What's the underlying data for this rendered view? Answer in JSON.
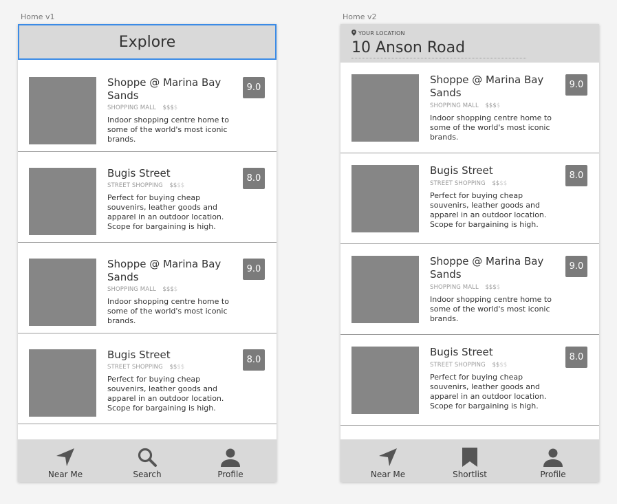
{
  "artboards": {
    "v1_label": "Home v1",
    "v2_label": "Home v2"
  },
  "v1": {
    "header_title": "Explore",
    "tabs": [
      {
        "label": "Near Me",
        "icon": "navigation-arrow-icon"
      },
      {
        "label": "Search",
        "icon": "search-icon"
      },
      {
        "label": "Profile",
        "icon": "person-icon"
      }
    ]
  },
  "v2": {
    "location_label": "YOUR LOCATION",
    "location_value": "10 Anson Road",
    "tabs": [
      {
        "label": "Near Me",
        "icon": "navigation-arrow-icon"
      },
      {
        "label": "Shortlist",
        "icon": "bookmark-icon"
      },
      {
        "label": "Profile",
        "icon": "person-icon"
      }
    ]
  },
  "listings": [
    {
      "title": "Shoppe @ Marina Bay Sands",
      "category": "SHOPPING MALL",
      "price_active": "$$$",
      "price_inactive": "$",
      "description": "Indoor shopping centre home to some of the world's most iconic brands.",
      "rating": "9.0"
    },
    {
      "title": "Bugis Street",
      "category": "STREET SHOPPING",
      "price_active": "$$",
      "price_inactive": "$$",
      "description": "Perfect for buying cheap souvenirs, leather goods and apparel in an outdoor location. Scope for bargaining is high.",
      "rating": "8.0"
    },
    {
      "title": "Shoppe @ Marina Bay Sands",
      "category": "SHOPPING MALL",
      "price_active": "$$$",
      "price_inactive": "$",
      "description": "Indoor shopping centre home to some of the world's most iconic brands.",
      "rating": "9.0"
    },
    {
      "title": "Bugis Street",
      "category": "STREET SHOPPING",
      "price_active": "$$",
      "price_inactive": "$$",
      "description": "Perfect for buying cheap souvenirs, leather goods and apparel in an outdoor location. Scope for bargaining is high.",
      "rating": "8.0"
    }
  ],
  "colors": {
    "header_bg": "#d9d9d9",
    "selection_border": "#3b8be6",
    "thumbnail": "#868686",
    "rating_badge": "#7b7b7b"
  }
}
